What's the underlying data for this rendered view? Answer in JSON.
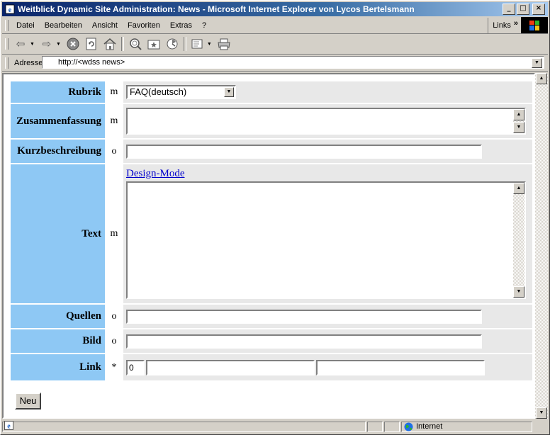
{
  "window": {
    "title": "Weitblick Dynamic Site Administration: News - Microsoft Internet Explorer von Lycos Bertelsmann",
    "minimize": "_",
    "maximize": "□",
    "close": "×"
  },
  "menu": {
    "items": [
      {
        "label": "Datei"
      },
      {
        "label": "Bearbeiten"
      },
      {
        "label": "Ansicht"
      },
      {
        "label": "Favoriten"
      },
      {
        "label": "Extras"
      },
      {
        "label": "?"
      }
    ],
    "links_label": "Links",
    "links_chevron": "»"
  },
  "toolbar": {
    "icons": [
      "back-icon",
      "forward-icon",
      "stop-icon",
      "refresh-icon",
      "home-icon",
      "search-icon",
      "favorites-icon",
      "history-icon",
      "mail-icon",
      "print-icon"
    ],
    "back_glyph": "⇦",
    "forward_glyph": "⇨",
    "stop_glyph": "✕",
    "refresh_glyph": "↻",
    "home_glyph": "⌂",
    "search_glyph": "🔍",
    "favorites_glyph": "★",
    "history_glyph": "◔",
    "mail_glyph": "✉",
    "print_glyph": "⎙"
  },
  "address": {
    "label": "Adresse",
    "value": "http://<wdss news>"
  },
  "form": {
    "rubrik": {
      "label": "Rubrik",
      "req": "m",
      "value": "FAQ(deutsch)"
    },
    "zusammenfassung": {
      "label": "Zusammenfassung",
      "req": "m",
      "value": ""
    },
    "kurzbeschreibung": {
      "label": "Kurzbeschreibung",
      "req": "o",
      "value": ""
    },
    "text": {
      "label": "Text",
      "req": "m",
      "design_mode": "Design-Mode",
      "value": ""
    },
    "quellen": {
      "label": "Quellen",
      "req": "o",
      "value": ""
    },
    "bild": {
      "label": "Bild",
      "req": "o",
      "value": ""
    },
    "link": {
      "label": "Link",
      "req": "*",
      "index": "0",
      "value1": "",
      "value2": ""
    },
    "neu_button": "Neu"
  },
  "status": {
    "zone": "Internet"
  }
}
